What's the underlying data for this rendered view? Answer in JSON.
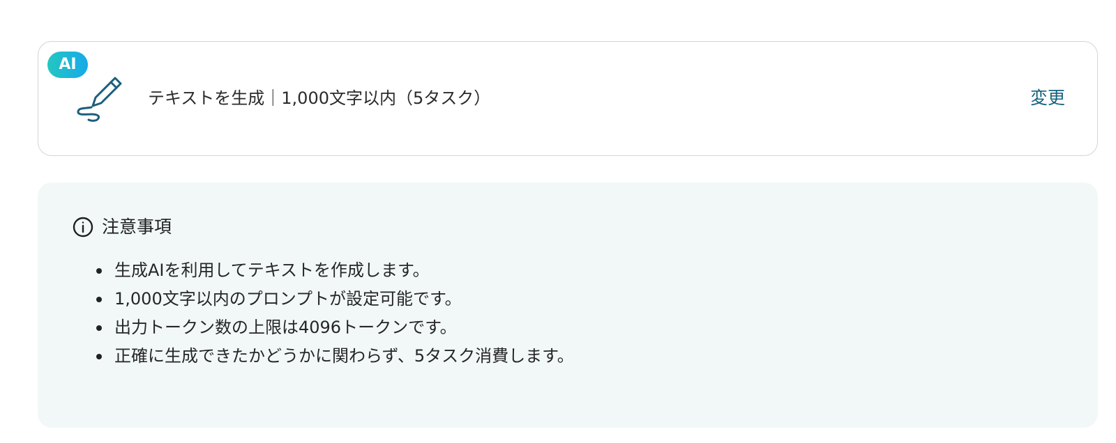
{
  "action": {
    "badge": "AI",
    "icon": "pen-icon",
    "title": "テキストを生成｜1,000文字以内（5タスク）",
    "change_label": "変更"
  },
  "notes": {
    "icon": "info-icon",
    "heading": "注意事項",
    "items": [
      "生成AIを利用してテキストを作成します。",
      "1,000文字以内のプロンプトが設定可能です。",
      "出力トークン数の上限は4096トークンです。",
      "正確に生成できたかどうかに関わらず、5タスク消費します。"
    ]
  },
  "colors": {
    "badge_gradient_start": "#23c7c1",
    "badge_gradient_end": "#17a9ea",
    "icon_stroke": "#1b5f7a",
    "link": "#14627e",
    "notes_background": "#f2f8f8",
    "card_border": "#d4d4d4"
  }
}
